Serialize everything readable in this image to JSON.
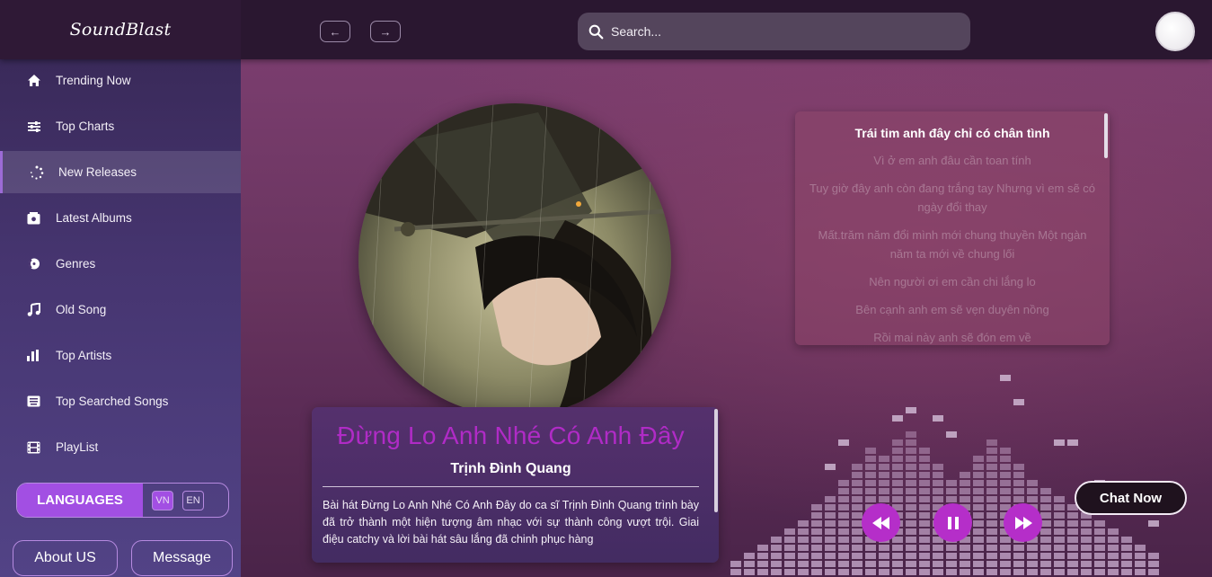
{
  "app": {
    "logo": "SoundBlast"
  },
  "header": {
    "back_icon": "arrow-left-icon",
    "forward_icon": "arrow-right-icon",
    "search_placeholder": "Search..."
  },
  "sidebar": {
    "items": [
      {
        "label": "Trending Now",
        "icon": "home-icon"
      },
      {
        "label": "Top Charts",
        "icon": "sliders-icon"
      },
      {
        "label": "New Releases",
        "icon": "loading-dots-icon",
        "active": true
      },
      {
        "label": "Latest Albums",
        "icon": "album-icon"
      },
      {
        "label": "Genres",
        "icon": "genres-icon"
      },
      {
        "label": "Old Song",
        "icon": "music-note-icon"
      },
      {
        "label": "Top Artists",
        "icon": "bar-chart-icon"
      },
      {
        "label": "Top Searched Songs",
        "icon": "keyboard-icon"
      },
      {
        "label": "PlayList",
        "icon": "film-icon"
      }
    ],
    "languages": {
      "title": "LANGUAGES",
      "options": [
        "VN",
        "EN"
      ],
      "selected": "VN"
    },
    "about_label": "About US",
    "message_label": "Message"
  },
  "player": {
    "song_title": "Đừng Lo Anh Nhé Có Anh Đây",
    "artist": "Trịnh Đình Quang",
    "description": "Bài hát Đừng Lo Anh Nhé Có Anh Đây do ca sĩ Trịnh Đình Quang trình bày đã trở thành một hiện tượng âm nhạc với sự thành công vượt trội. Giai điệu catchy và lời bài hát sâu lắng đã chinh phục hàng",
    "lyrics": {
      "current": "Trái tim anh đây chỉ có chân tình",
      "lines": [
        "Vì ở em anh đâu cần toan tính",
        "Tuy giờ đây anh còn đang trắng tay Nhưng vì em sẽ có ngày đổi thay",
        "Mất.trăm năm đổi mình mới chung thuyền Một ngàn năm ta mới về chung lối",
        "Nên người ơi em cần chi lắng lo",
        "Bên cạnh anh em sẽ vẹn duyên nồng",
        "Rồi mai này anh sẽ đón em về"
      ]
    },
    "controls": {
      "rewind_icon": "rewind-icon",
      "pause_icon": "pause-icon",
      "forward_icon": "fast-forward-icon"
    },
    "chat_label": "Chat Now"
  },
  "colors": {
    "accent": "#a24fe3",
    "title": "#b02bc6",
    "control": "#b52ec9"
  }
}
